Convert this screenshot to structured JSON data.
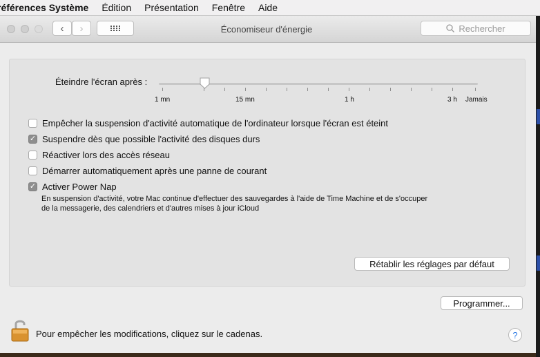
{
  "menubar": {
    "app_name": "références Système",
    "items": [
      "Édition",
      "Présentation",
      "Fenêtre",
      "Aide"
    ]
  },
  "window": {
    "title": "Économiseur d'énergie",
    "search": {
      "placeholder": "Rechercher"
    }
  },
  "slider": {
    "label": "Éteindre l'écran après :",
    "tick_labels": [
      "1 mn",
      "15 mn",
      "1 h",
      "3 h",
      "Jamais"
    ],
    "value": "4 mn"
  },
  "options": [
    {
      "label": "Empêcher la suspension d'activité automatique de l'ordinateur lorsque l'écran est éteint",
      "checked": false
    },
    {
      "label": "Suspendre dès que possible l'activité des disques durs",
      "checked": true
    },
    {
      "label": "Réactiver lors des accès réseau",
      "checked": false
    },
    {
      "label": "Démarrer automatiquement après une panne de courant",
      "checked": false
    },
    {
      "label": "Activer Power Nap",
      "checked": true
    }
  ],
  "power_nap_description": "En suspension d'activité, votre Mac continue d'effectuer des sauvegardes à l'aide de Time Machine et de s'occuper de la messagerie, des calendriers et d'autres mises à jour iCloud",
  "buttons": {
    "restore_defaults": "Rétablir les réglages par défaut",
    "schedule": "Programmer..."
  },
  "footer": {
    "lock_text": "Pour empêcher les modifications, cliquez sur le cadenas.",
    "help": "?"
  }
}
